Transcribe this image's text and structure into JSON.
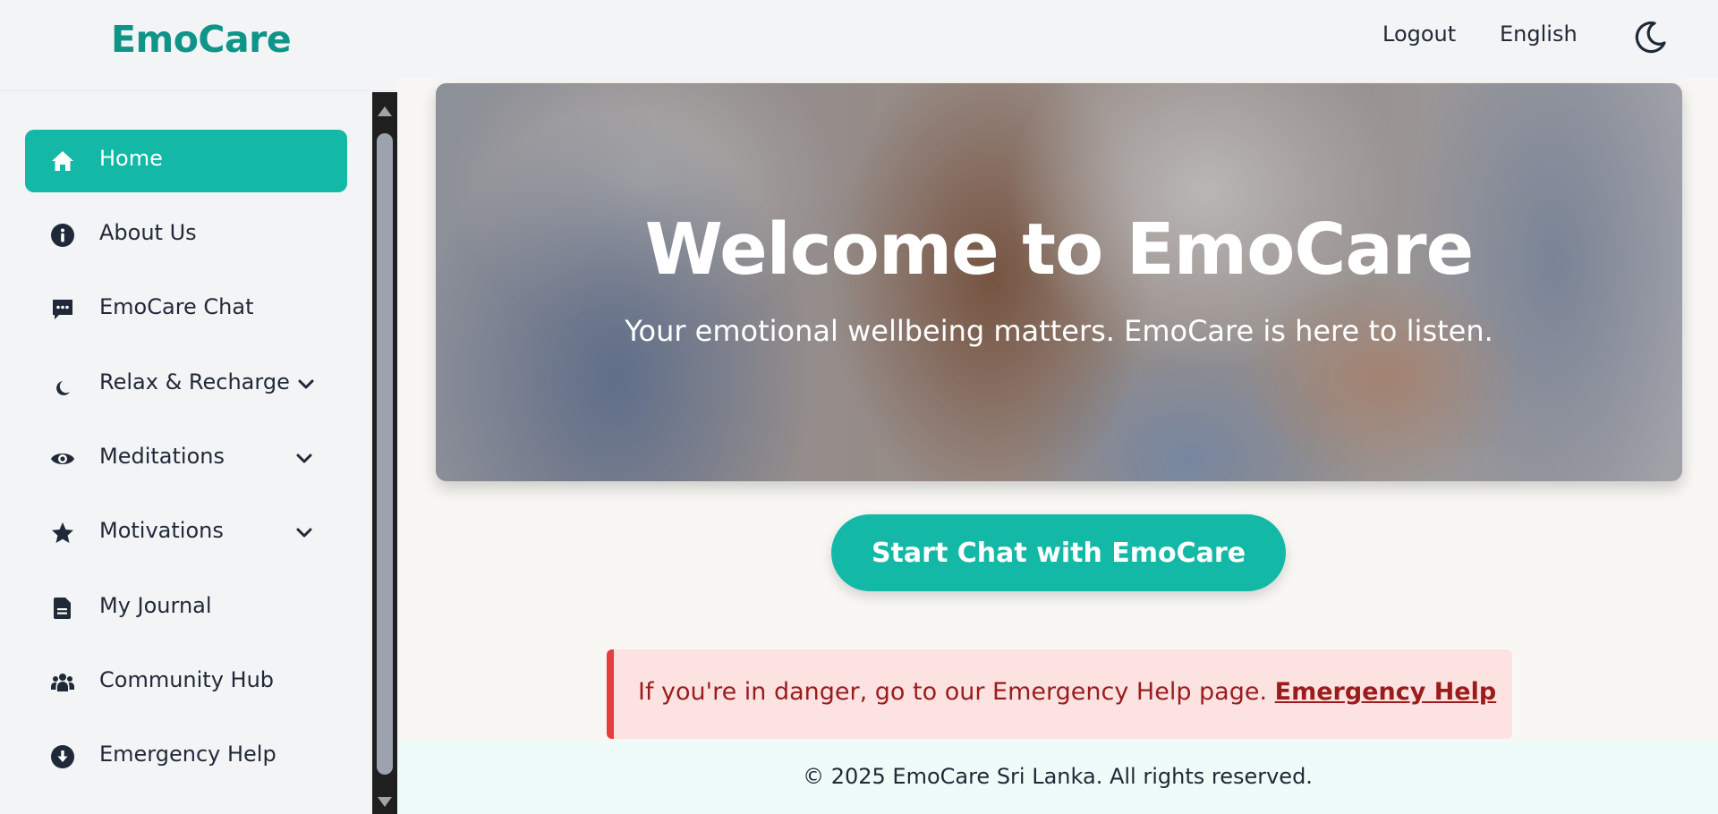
{
  "header": {
    "brand": "EmoCare",
    "logout_label": "Logout",
    "language_label": "English",
    "theme_icon": "moon-icon"
  },
  "sidebar": {
    "items": [
      {
        "label": "Home",
        "icon": "home-icon",
        "active": true
      },
      {
        "label": "About Us",
        "icon": "info-icon"
      },
      {
        "label": "EmoCare Chat",
        "icon": "chat-icon"
      },
      {
        "label": "Relax & Recharge",
        "icon": "moon-small-icon",
        "has_dropdown": true
      },
      {
        "label": "Meditations",
        "icon": "eye-icon",
        "has_dropdown": true
      },
      {
        "label": "Motivations",
        "icon": "star-icon",
        "has_dropdown": true
      },
      {
        "label": "My Journal",
        "icon": "journal-icon"
      },
      {
        "label": "Community Hub",
        "icon": "users-icon"
      },
      {
        "label": "Emergency Help",
        "icon": "arrow-down-circle-icon"
      }
    ]
  },
  "hero": {
    "title": "Welcome to EmoCare",
    "subtitle": "Your emotional wellbeing matters. EmoCare is here to listen."
  },
  "cta": {
    "label": "Start Chat with EmoCare"
  },
  "alert": {
    "text": "If you're in danger, go to our Emergency Help page. ",
    "link_label": "Emergency Help"
  },
  "footer": {
    "text": "© 2025 EmoCare Sri Lanka. All rights reserved."
  },
  "colors": {
    "accent": "#14b8a6",
    "brand": "#0f9488",
    "alert_bg": "#fde2e2",
    "alert_border": "#e53e3e",
    "alert_text": "#9b1c1c"
  }
}
